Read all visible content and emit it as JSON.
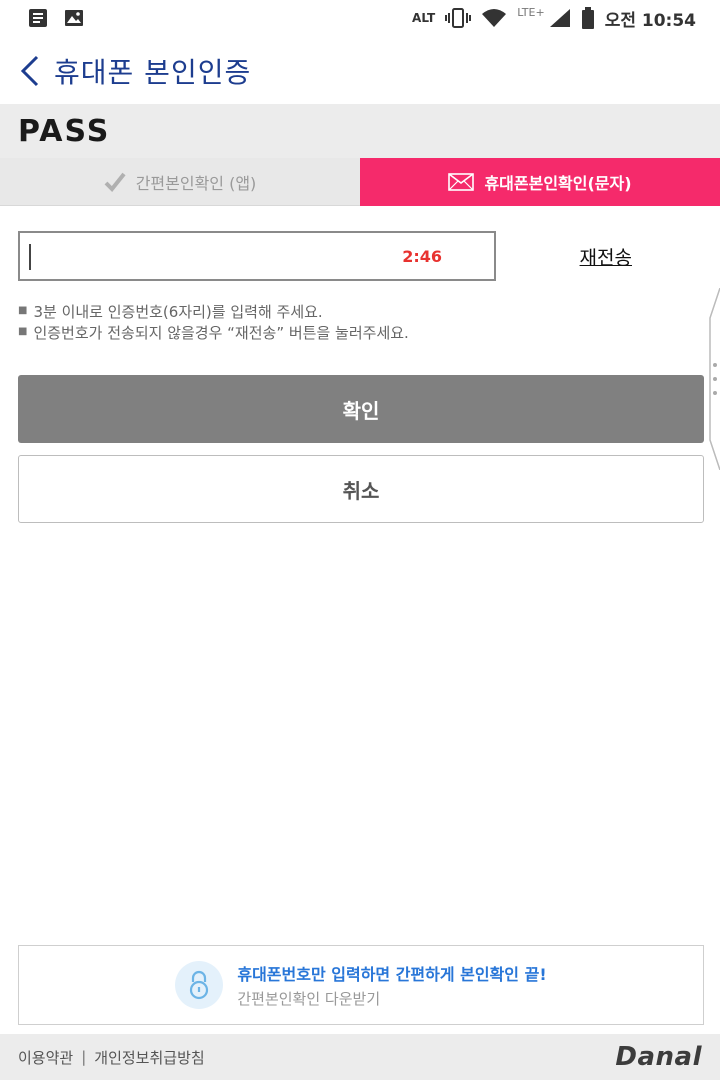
{
  "status_bar": {
    "carrier": "LTE+",
    "alt_label": "ALT",
    "time": "오전 10:54"
  },
  "header": {
    "title": "휴대폰 본인인증"
  },
  "brand": {
    "pass_logo": "PASS"
  },
  "tabs": [
    {
      "label": "간편본인확인 (앱)",
      "active": false
    },
    {
      "label": "휴대폰본인확인(문자)",
      "active": true
    }
  ],
  "form": {
    "code_value": "",
    "timer": "2:46",
    "resend_label": "재전송"
  },
  "notes": [
    "3분 이내로 인증번호(6자리)를 입력해 주세요.",
    "인증번호가 전송되지 않을경우 “재전송” 버튼을 눌러주세요."
  ],
  "buttons": {
    "confirm": "확인",
    "cancel": "취소"
  },
  "promo": {
    "main": "휴대폰번호만 입력하면 간편하게 본인확인 끝!",
    "sub": "간편본인확인 다운받기"
  },
  "footer": {
    "terms": "이용약관",
    "separator": "|",
    "privacy": "개인정보취급방침",
    "logo": "Danal"
  },
  "colors": {
    "accent_pink": "#f52a6b",
    "title_blue": "#1d3d8f",
    "timer_red": "#e8322f",
    "promo_blue": "#2876d8"
  }
}
